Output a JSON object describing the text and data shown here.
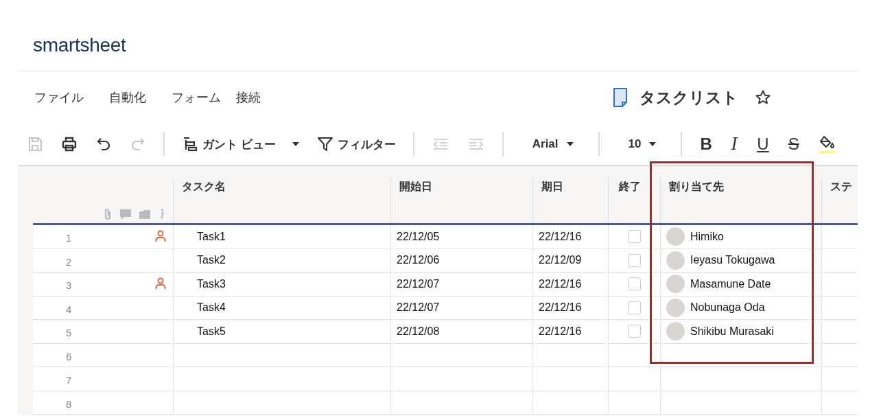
{
  "brand": {
    "logo": "smartsheet"
  },
  "menu": [
    {
      "label": "ファイル"
    },
    {
      "label": "自動化"
    },
    {
      "label": "フォーム"
    },
    {
      "label": "接続"
    }
  ],
  "sheet": {
    "title": "タスクリスト",
    "favorite": false
  },
  "toolbar": {
    "history_buttons": [
      {
        "disabled": true
      },
      {
        "disabled": false
      },
      {
        "disabled": false
      },
      {
        "disabled": true
      }
    ],
    "view_menu": {
      "label": "ガント ビュー"
    },
    "filter": {
      "label": "フィルター"
    },
    "indent_buttons": [
      {
        "disabled": true
      },
      {
        "disabled": true
      }
    ],
    "font": {
      "value": "Arial"
    },
    "size": {
      "value": "10"
    },
    "format_buttons": [
      {
        "label": "B",
        "kind": "bold"
      },
      {
        "label": "I",
        "kind": "italic"
      },
      {
        "label": "U",
        "kind": "underline"
      },
      {
        "label": "S",
        "kind": "strike"
      }
    ]
  },
  "table": {
    "columns": [
      "タスク名",
      "開始日",
      "期日",
      "終了",
      "割り当て先",
      "ステ"
    ],
    "rows": [
      {
        "number": "1",
        "assigned": true,
        "task": "Task1",
        "start": "22/12/05",
        "due": "22/12/16",
        "done": false,
        "assignee": "Himiko"
      },
      {
        "number": "2",
        "assigned": false,
        "task": "Task2",
        "start": "22/12/06",
        "due": "22/12/09",
        "done": false,
        "assignee": "Ieyasu Tokugawa"
      },
      {
        "number": "3",
        "assigned": true,
        "task": "Task3",
        "start": "22/12/07",
        "due": "22/12/16",
        "done": false,
        "assignee": "Masamune Date"
      },
      {
        "number": "4",
        "assigned": false,
        "task": "Task4",
        "start": "22/12/07",
        "due": "22/12/16",
        "done": false,
        "assignee": "Nobunaga Oda"
      },
      {
        "number": "5",
        "assigned": false,
        "task": "Task5",
        "start": "22/12/08",
        "due": "22/12/16",
        "done": false,
        "assignee": "Shikibu Murasaki"
      },
      {
        "number": "6"
      },
      {
        "number": "7"
      },
      {
        "number": "8"
      }
    ]
  }
}
